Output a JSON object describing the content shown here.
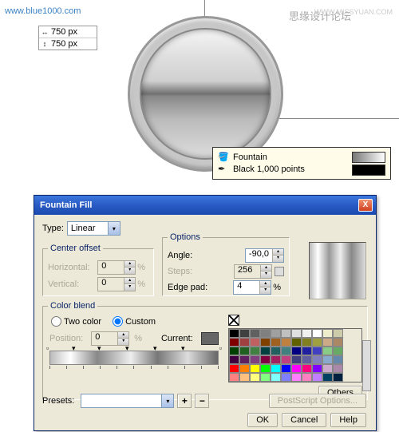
{
  "url": "www.blue1000.com",
  "watermark1": "思缘设计论坛",
  "watermark2": "WWW.MISSYUAN.COM",
  "dims": {
    "w": "750 px",
    "h": "750 px"
  },
  "tooltip": {
    "fill_label": "Fountain",
    "outline_label": "Black  1,000 points"
  },
  "dialog": {
    "title": "Fountain Fill",
    "type_label": "Type:",
    "type_value": "Linear",
    "center_offset": {
      "title": "Center offset",
      "h_label": "Horizontal:",
      "h_value": "0",
      "v_label": "Vertical:",
      "v_value": "0",
      "pct": "%"
    },
    "options": {
      "title": "Options",
      "angle_label": "Angle:",
      "angle_value": "-90,0",
      "steps_label": "Steps:",
      "steps_value": "256",
      "edge_label": "Edge pad:",
      "edge_value": "4",
      "pct": "%"
    },
    "color_blend": {
      "title": "Color blend",
      "two_color": "Two color",
      "custom": "Custom",
      "position_label": "Position:",
      "position_value": "0",
      "current_label": "Current:",
      "others": "Others",
      "pct": "%"
    },
    "presets_label": "Presets:",
    "ps_options": "PostScript Options...",
    "ok": "OK",
    "cancel": "Cancel",
    "help": "Help"
  },
  "palette": [
    "#000000",
    "#404040",
    "#606060",
    "#808080",
    "#a0a0a0",
    "#c0c0c0",
    "#e0e0e0",
    "#f0f0f0",
    "#ffffff",
    "#eeeecc",
    "#ccccaa",
    "#800000",
    "#a04040",
    "#c06060",
    "#804000",
    "#a06020",
    "#c08040",
    "#606000",
    "#808020",
    "#a0a040",
    "#ccaa88",
    "#aa8866",
    "#004000",
    "#206020",
    "#408040",
    "#004040",
    "#206060",
    "#408080",
    "#000080",
    "#2020a0",
    "#4040c0",
    "#88cc88",
    "#66aa66",
    "#400040",
    "#602060",
    "#804080",
    "#800040",
    "#a02060",
    "#c04080",
    "#404080",
    "#6060a0",
    "#8080c0",
    "#88aacc",
    "#6688aa",
    "#ff0000",
    "#ff8000",
    "#ffff00",
    "#00ff00",
    "#00ffff",
    "#0000ff",
    "#ff00ff",
    "#ff0080",
    "#8000ff",
    "#ccaacc",
    "#aa88aa",
    "#ff8080",
    "#ffc080",
    "#ffff80",
    "#80ff80",
    "#80ffff",
    "#8080ff",
    "#ff80ff",
    "#ff80c0",
    "#c080ff",
    "#004060",
    "#002040"
  ]
}
